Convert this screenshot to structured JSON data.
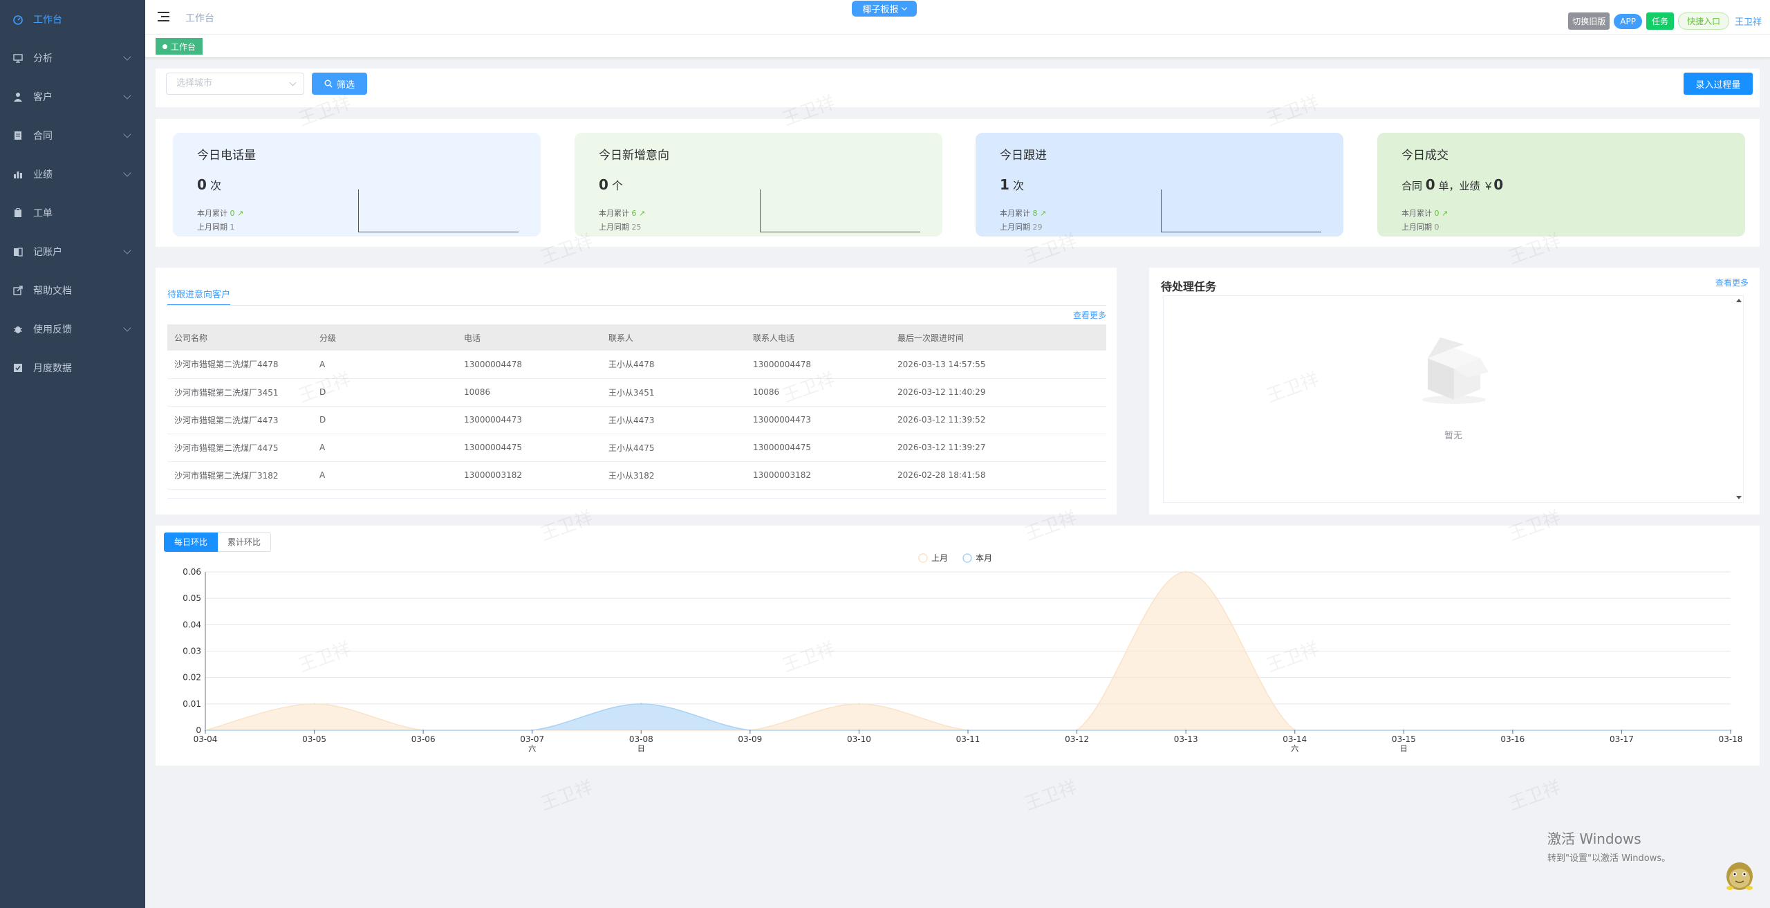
{
  "sidebar": {
    "items": [
      {
        "label": "工作台",
        "icon": "dashboard-icon",
        "active": true,
        "has_children": false
      },
      {
        "label": "分析",
        "icon": "chart-icon",
        "active": false,
        "has_children": true
      },
      {
        "label": "客户",
        "icon": "user-icon",
        "active": false,
        "has_children": true
      },
      {
        "label": "合同",
        "icon": "document-icon",
        "active": false,
        "has_children": true
      },
      {
        "label": "业绩",
        "icon": "bar-chart-icon",
        "active": false,
        "has_children": true
      },
      {
        "label": "工单",
        "icon": "clipboard-icon",
        "active": false,
        "has_children": false
      },
      {
        "label": "记账户",
        "icon": "book-icon",
        "active": false,
        "has_children": true
      },
      {
        "label": "帮助文档",
        "icon": "external-link-icon",
        "active": false,
        "has_children": false
      },
      {
        "label": "使用反馈",
        "icon": "bug-icon",
        "active": false,
        "has_children": true
      },
      {
        "label": "月度数据",
        "icon": "checkbox-icon",
        "active": false,
        "has_children": false
      }
    ]
  },
  "navbar": {
    "breadcrumb": "工作台",
    "board_button": "椰子板报",
    "switch_old": "切换旧版",
    "app": "APP",
    "task": "任务",
    "quick_entry": "快捷入口",
    "user": "王卫祥"
  },
  "tags": {
    "current": "工作台"
  },
  "filter": {
    "city_placeholder": "选择城市",
    "filter_button": "筛选",
    "entry_button": "录入过程量"
  },
  "stats": [
    {
      "title": "今日电话量",
      "value": "0",
      "unit": "次",
      "month_label": "本月累计",
      "month_value": "0",
      "last_label": "上月同期",
      "last_value": "1",
      "bg": "#ecf4ff"
    },
    {
      "title": "今日新增意向",
      "value": "0",
      "unit": "个",
      "month_label": "本月累计",
      "month_value": "6",
      "last_label": "上月同期",
      "last_value": "25",
      "bg": "#eef8ea"
    },
    {
      "title": "今日跟进",
      "value": "1",
      "unit": "次",
      "month_label": "本月累计",
      "month_value": "8",
      "last_label": "上月同期",
      "last_value": "29",
      "bg": "#d9eaff"
    },
    {
      "title": "今日成交",
      "contract_prefix": "合同",
      "contract_value": "0",
      "contract_unit": "单，业绩 ￥",
      "amount": "0",
      "month_label": "本月累计",
      "month_value": "0",
      "last_label": "上月同期",
      "last_value": "0",
      "bg": "#dff2d8"
    }
  ],
  "follow": {
    "tab": "待跟进意向客户",
    "more": "查看更多",
    "columns": [
      "公司名称",
      "分级",
      "电话",
      "联系人",
      "联系人电话",
      "最后一次跟进时间"
    ],
    "rows": [
      [
        "沙河市猎辊第二洗煤厂4478",
        "A",
        "13000004478",
        "王小从4478",
        "13000004478",
        "2026-03-13 14:57:55"
      ],
      [
        "沙河市猎辊第二洗煤厂3451",
        "D",
        "10086",
        "王小从3451",
        "10086",
        "2026-03-12 11:40:29"
      ],
      [
        "沙河市猎辊第二洗煤厂4473",
        "D",
        "13000004473",
        "王小从4473",
        "13000004473",
        "2026-03-12 11:39:52"
      ],
      [
        "沙河市猎辊第二洗煤厂4475",
        "A",
        "13000004475",
        "王小从4475",
        "13000004475",
        "2026-03-12 11:39:27"
      ],
      [
        "沙河市猎辊第二洗煤厂3182",
        "A",
        "13000003182",
        "王小从3182",
        "13000003182",
        "2026-02-28 18:41:58"
      ]
    ]
  },
  "tasks": {
    "title": "待处理任务",
    "more": "查看更多",
    "empty": "暂无"
  },
  "chart_tabs": {
    "daily": "每日环比",
    "cumulative": "累计环比"
  },
  "chart_data": {
    "type": "area",
    "x": [
      "03-04",
      "03-05",
      "03-06",
      "03-07",
      "03-08",
      "03-09",
      "03-10",
      "03-11",
      "03-12",
      "03-13",
      "03-14",
      "03-15",
      "03-16",
      "03-17",
      "03-18"
    ],
    "x_sub": {
      "03-07": "六",
      "03-08": "日",
      "03-14": "六",
      "03-15": "日"
    },
    "series": [
      {
        "name": "上月",
        "color": "#fbe3c8",
        "values": [
          0,
          0.01,
          0,
          0,
          0,
          0,
          0.01,
          0,
          0,
          0.06,
          0,
          0,
          0,
          0,
          0
        ]
      },
      {
        "name": "本月",
        "color": "#a9d2f5",
        "values": [
          0,
          0,
          0,
          0,
          0.01,
          0,
          0,
          0,
          0,
          0,
          0,
          0,
          0,
          0,
          0
        ]
      }
    ],
    "y_ticks": [
      0,
      0.01,
      0.02,
      0.03,
      0.04,
      0.05,
      0.06
    ],
    "ylim": [
      0,
      0.06
    ],
    "grid": true,
    "legend": "top-center"
  },
  "windows_activation": {
    "line1": "激活 Windows",
    "line2": "转到\"设置\"以激活 Windows。"
  },
  "watermark": "王卫祥"
}
